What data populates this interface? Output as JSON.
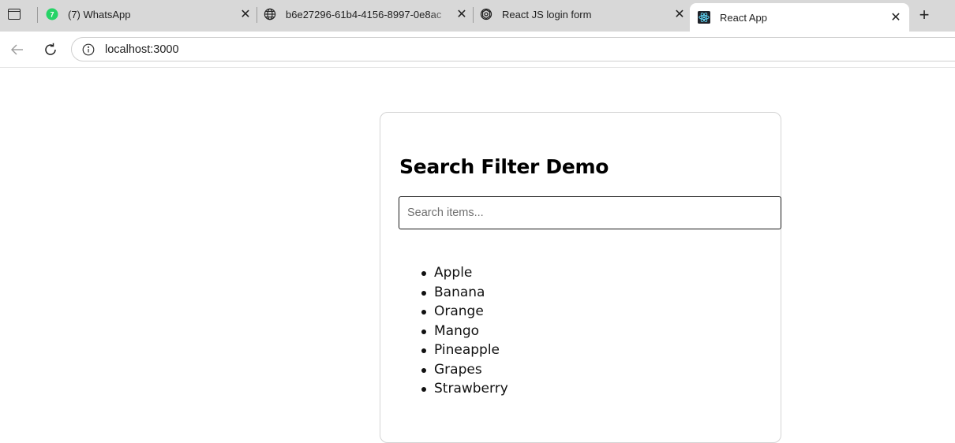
{
  "browser": {
    "tabs": [
      {
        "title": "(7) WhatsApp",
        "favicon": "whatsapp-icon",
        "badge": "7",
        "active": false
      },
      {
        "title": "b6e27296-61b4-4156-8997-0e8ac",
        "favicon": "globe-icon",
        "active": false
      },
      {
        "title": "React JS login form",
        "favicon": "chatgpt-icon",
        "active": false
      },
      {
        "title": "React App",
        "favicon": "react-icon",
        "active": true
      }
    ],
    "new_tab_label": "+",
    "close_label": "✕",
    "address": "localhost:3000",
    "colors": {
      "tabstrip": "#d8d8d8",
      "whatsapp": "#25d366",
      "react": "#61dafb"
    }
  },
  "app": {
    "title": "Search Filter Demo",
    "search": {
      "placeholder": "Search items...",
      "value": ""
    },
    "items": [
      "Apple",
      "Banana",
      "Orange",
      "Mango",
      "Pineapple",
      "Grapes",
      "Strawberry"
    ]
  }
}
